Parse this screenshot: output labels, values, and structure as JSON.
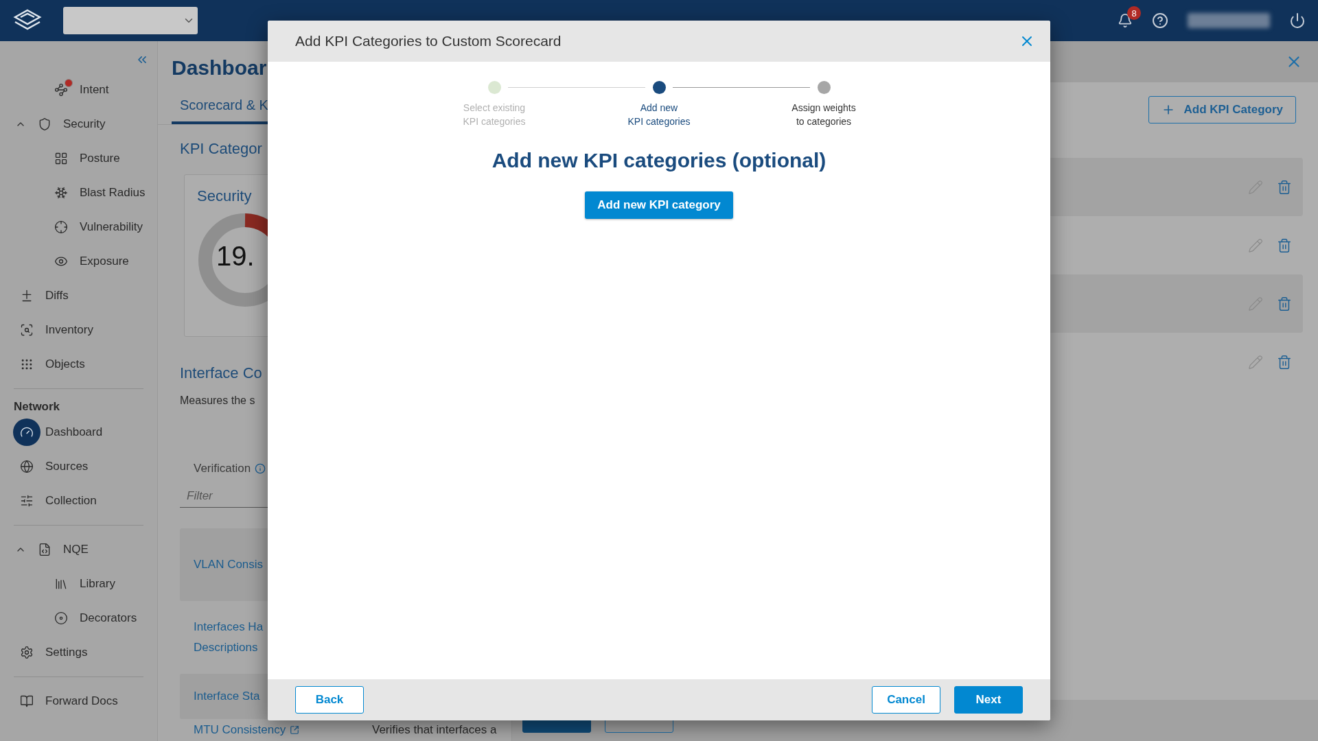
{
  "top_bar": {
    "notifications": {
      "count": "8"
    }
  },
  "sidebar": {
    "continued_children": [
      {
        "label": "Intent",
        "alert": true,
        "selected": false
      }
    ],
    "items": [
      {
        "label": "Security",
        "expanded": true,
        "selected": false,
        "children": [
          {
            "label": "Posture",
            "selected": false
          },
          {
            "label": "Blast Radius",
            "selected": false
          },
          {
            "label": "Vulnerability",
            "selected": false
          },
          {
            "label": "Exposure",
            "selected": false
          }
        ]
      },
      {
        "label": "Diffs",
        "selected": false
      },
      {
        "label": "Inventory",
        "selected": false
      },
      {
        "label": "Objects",
        "selected": false
      }
    ],
    "sections": [
      {
        "title": "Network",
        "items": [
          {
            "label": "Dashboard",
            "selected": true
          },
          {
            "label": "Sources",
            "selected": false
          },
          {
            "label": "Collection",
            "selected": false
          }
        ]
      },
      {
        "items": [
          {
            "label": "NQE",
            "expanded": true,
            "selected": false,
            "children": [
              {
                "label": "Library",
                "selected": false
              },
              {
                "label": "Decorators",
                "selected": false
              }
            ]
          },
          {
            "label": "Settings",
            "selected": false
          }
        ]
      },
      {
        "items": [
          {
            "label": "Forward Docs",
            "selected": false
          }
        ]
      }
    ]
  },
  "main": {
    "title": "Dashboar",
    "tabs": [
      {
        "label": "Scorecard & K",
        "selected": true
      }
    ],
    "section_title": "KPI Categor",
    "card": {
      "title": "Security",
      "score": "19."
    },
    "category": {
      "title": "Interface Co",
      "description": "Measures the s",
      "column_1": "Verification",
      "filter": {
        "placeholder": "Filter"
      },
      "rows": [
        {
          "lines": [
            "VLAN Consis"
          ]
        },
        {
          "lines": [
            "Interfaces Ha",
            "Descriptions"
          ]
        },
        {
          "lines": [
            "Interface Sta"
          ]
        },
        {
          "lines": [
            "MTU Consistency"
          ],
          "external": true,
          "column_2": "Verifies that interfaces a"
        }
      ]
    }
  },
  "drawer": {
    "add_button": "Add KPI Category",
    "rows": [
      {
        "actions": [
          {
            "kind": "edit"
          },
          {
            "kind": "delete"
          }
        ]
      },
      {
        "actions": [
          {
            "kind": "edit"
          },
          {
            "kind": "delete"
          }
        ]
      },
      {
        "actions": [
          {
            "kind": "edit"
          },
          {
            "kind": "delete"
          }
        ]
      },
      {
        "actions": [
          {
            "kind": "edit"
          },
          {
            "kind": "delete"
          }
        ]
      }
    ],
    "footer": [
      {
        "kind": "primary"
      },
      {
        "kind": "secondary"
      }
    ]
  },
  "dialog": {
    "title": "Add KPI Categories to Custom Scorecard",
    "steps": [
      {
        "lines": [
          "Select existing",
          "KPI categories"
        ],
        "completed": true,
        "selected": false
      },
      {
        "lines": [
          "Add new",
          "KPI categories"
        ],
        "completed": false,
        "selected": true
      },
      {
        "lines": [
          "Assign weights",
          "to categories"
        ],
        "completed": false,
        "selected": false
      }
    ],
    "heading": "Add new KPI categories (optional)",
    "action": "Add new KPI category",
    "buttons": [
      {
        "label": "Back",
        "kind": "secondary"
      },
      {
        "label": "Cancel",
        "kind": "secondary"
      },
      {
        "label": "Next",
        "kind": "primary"
      }
    ]
  }
}
